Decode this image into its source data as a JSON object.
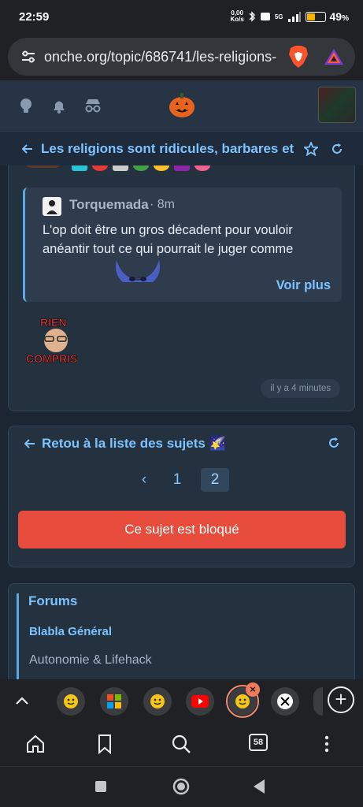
{
  "status_bar": {
    "time": "22:59",
    "net_speed": "0,00",
    "net_unit": "Ko/s",
    "battery": "49",
    "battery_fill": 0.49,
    "battery_unit": "%",
    "network": "5G"
  },
  "browser": {
    "url": "onche.org/topic/686741/les-religions-",
    "tab_count": "58"
  },
  "topic": {
    "title": "Les religions sont ridicules, barbares et s"
  },
  "quote": {
    "author": "Torquemada",
    "time": "· 8m",
    "text": "L'op doit être un gros décadent pour vouloir anéantir tout ce qui pourrait le juger comme",
    "more_label": "Voir plus"
  },
  "reaction_sticker": {
    "top_text": "RIEN",
    "bottom_text": "COMPRIS"
  },
  "post_timestamp": "il y a 4 minutes",
  "navigation": {
    "back_label": "Retou à la liste des sujets 🌠",
    "pages": [
      "1",
      "2"
    ],
    "current_page": "2",
    "prev_symbol": "‹",
    "locked_label": "Ce sujet est bloqué"
  },
  "forums": {
    "title": "Forums",
    "items": [
      "Blabla Général",
      "Autonomie & Lifehack"
    ]
  },
  "colors": {
    "accent": "#7cc3ff",
    "locked": "#e74c3c",
    "card": "#24313f"
  }
}
